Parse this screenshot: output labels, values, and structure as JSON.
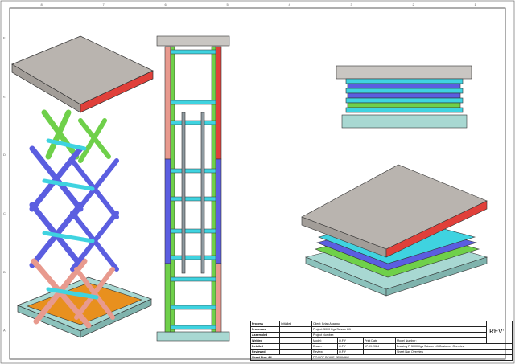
{
  "drawing": {
    "border_letters_left": [
      "F",
      "E",
      "D",
      "C",
      "B",
      "A"
    ],
    "border_numbers_top": [
      "8",
      "7",
      "6",
      "5",
      "4",
      "3",
      "2",
      "1"
    ],
    "colors": {
      "platform": "#b9b4af",
      "red_arm": "#e0403a",
      "green_arm": "#6fd04a",
      "blue_arm": "#5b5ee0",
      "cyan_tube": "#3fd3e0",
      "salmon_arm": "#e89a8e",
      "base_frame": "#a8d8d2",
      "base_plate": "#e8901e",
      "grey_cylinder": "#8e9aa0"
    }
  },
  "title_block": {
    "rows": [
      {
        "label": "Process",
        "value": "Initialled"
      },
      {
        "label": "Processed",
        "value": ""
      },
      {
        "label": "Assembled",
        "value": ""
      },
      {
        "label": "Welded",
        "value": ""
      },
      {
        "label": "Detailed",
        "value": ""
      },
      {
        "label": "Reviewed",
        "value": ""
      }
    ],
    "mid": [
      {
        "label": "Model:",
        "value": "O.F.Y",
        "c3": "Print Date",
        "c4": ""
      },
      {
        "label": "Drawn:",
        "value": "O.F.Y",
        "c3": "17.09.2024",
        "c4": ""
      },
      {
        "label": "Review:",
        "value": "O.F.Y",
        "c3": "",
        "c4": ""
      }
    ],
    "client": "Client: Brian Anaagu",
    "project": "Project: 5000 Kgs Scissor Lift",
    "project_number": "Project Number:",
    "model_number": "Model Number:",
    "drawing_file_name": "Drawing File Name:",
    "drawing_file_value": "5000 Kgs Scissor Lift Customer Overview",
    "sheet_name": "Sheet Name:",
    "sheet_name_value": "Overview",
    "sheet_size": "Sheet Size: A4",
    "do_not_scale": "DO NOT SCALE DRAWING",
    "rev": "REV:"
  }
}
